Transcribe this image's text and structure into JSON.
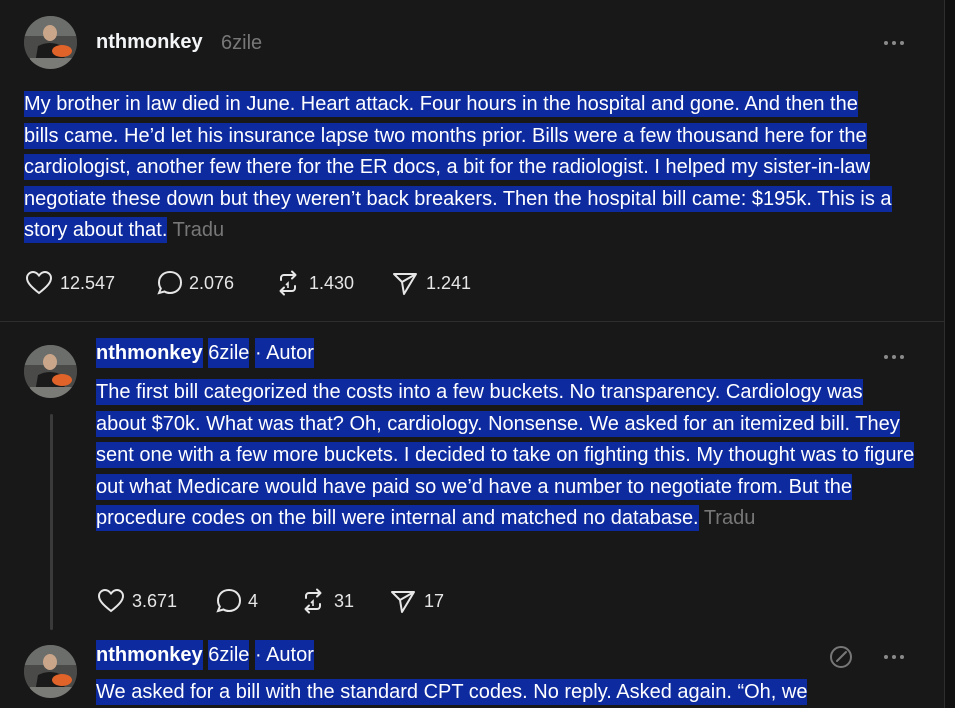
{
  "posts": [
    {
      "username": "nthmonkey",
      "time": "6zile",
      "author_tag": "",
      "text": "My brother in law died in June. Heart attack. Four hours in the hospital and gone. And then the bills came. He’d let his insurance lapse two months prior. Bills were a few thousand here for the cardiologist, another few there for the ER docs, a bit for the radiologist. I helped my sister-in-law negotiate these down but they weren’t back breakers. Then the hospital bill came: $195k. This is a story about that.",
      "translate": "Tradu",
      "likes": "12.547",
      "replies": "2.076",
      "reposts": "1.430",
      "shares": "1.241"
    },
    {
      "username": "nthmonkey",
      "time": "6zile",
      "author_tag": "· Autor",
      "text": "The first bill categorized the costs into a few buckets. No transparency. Cardiology was about $70k. What was that? Oh, cardiology. Nonsense. We asked for an itemized bill. They sent one with a few more buckets. I decided to take on fighting this. My thought was to figure out what Medicare would have paid so we’d have a number to negotiate from. But the procedure codes on the bill were internal and matched no database.",
      "translate": "Tradu",
      "likes": "3.671",
      "replies": "4",
      "reposts": "31",
      "shares": "17"
    },
    {
      "username": "nthmonkey",
      "time": "6zile",
      "author_tag": "· Autor",
      "text": "We asked for a bill with the standard CPT codes. No reply. Asked again. “Oh, we"
    }
  ],
  "icons": {
    "more": "more-horizontal-icon",
    "like": "heart-icon",
    "reply": "comment-icon",
    "repost": "repost-icon",
    "share": "share-icon",
    "edit": "edit-icon"
  },
  "colors": {
    "background": "#181818",
    "highlight": "#0d2a9e",
    "muted": "#777777"
  }
}
